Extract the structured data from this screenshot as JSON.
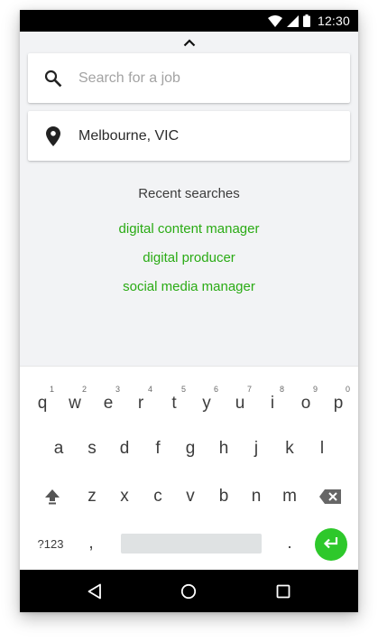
{
  "status_bar": {
    "time": "12:30",
    "icons": [
      "wifi-icon",
      "cell-signal-icon",
      "battery-icon"
    ]
  },
  "search": {
    "placeholder": "Search for a job",
    "value": "",
    "icon": "search-icon"
  },
  "location": {
    "value": "Melbourne, VIC",
    "icon": "location-pin-icon"
  },
  "recent": {
    "title": "Recent searches",
    "items": [
      "digital content manager",
      "digital producer",
      "social media manager"
    ]
  },
  "keyboard": {
    "row1": [
      {
        "ch": "q",
        "hint": "1"
      },
      {
        "ch": "w",
        "hint": "2"
      },
      {
        "ch": "e",
        "hint": "3"
      },
      {
        "ch": "r",
        "hint": "4"
      },
      {
        "ch": "t",
        "hint": "5"
      },
      {
        "ch": "y",
        "hint": "6"
      },
      {
        "ch": "u",
        "hint": "7"
      },
      {
        "ch": "i",
        "hint": "8"
      },
      {
        "ch": "o",
        "hint": "9"
      },
      {
        "ch": "p",
        "hint": "0"
      }
    ],
    "row2": [
      "a",
      "s",
      "d",
      "f",
      "g",
      "h",
      "j",
      "k",
      "l"
    ],
    "row3": [
      "z",
      "x",
      "c",
      "v",
      "b",
      "n",
      "m"
    ],
    "symbols_label": "?123",
    "comma": ",",
    "period": "."
  },
  "colors": {
    "accent_green": "#2aab14",
    "enter_green": "#2ec82b",
    "background": "#f2f3f5"
  }
}
